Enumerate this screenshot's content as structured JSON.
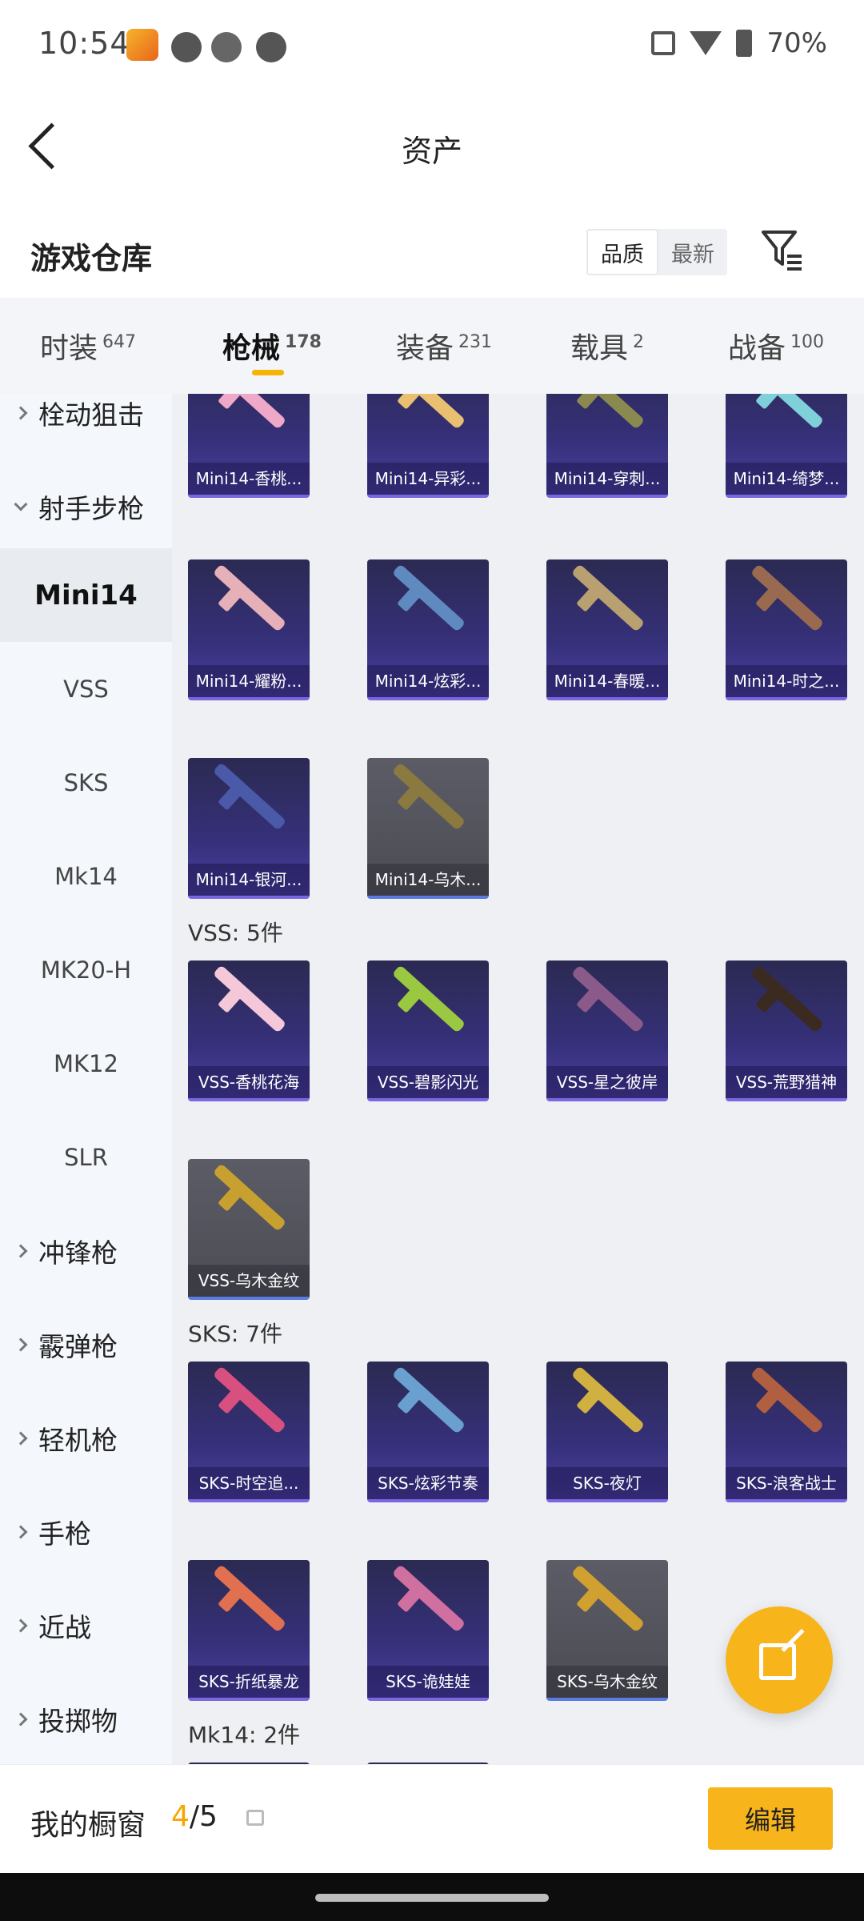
{
  "status_bar": {
    "time": "10:54",
    "battery": "70%"
  },
  "header": {
    "title": "资产"
  },
  "section": {
    "title": "游戏仓库",
    "sort_quality": "品质",
    "sort_latest": "最新"
  },
  "tabs": [
    {
      "label": "时装",
      "count": "647"
    },
    {
      "label": "枪械",
      "count": "178"
    },
    {
      "label": "装备",
      "count": "231"
    },
    {
      "label": "载具",
      "count": "2"
    },
    {
      "label": "战备",
      "count": "100"
    }
  ],
  "sidebar": {
    "items": [
      {
        "label": "栓动狙击"
      },
      {
        "label": "射手步枪"
      },
      {
        "label": "Mini14"
      },
      {
        "label": "VSS"
      },
      {
        "label": "SKS"
      },
      {
        "label": "Mk14"
      },
      {
        "label": "MK20-H"
      },
      {
        "label": "MK12"
      },
      {
        "label": "SLR"
      },
      {
        "label": "冲锋枪"
      },
      {
        "label": "霰弹枪"
      },
      {
        "label": "轻机枪"
      },
      {
        "label": "手枪"
      },
      {
        "label": "近战"
      },
      {
        "label": "投掷物"
      }
    ]
  },
  "groups": {
    "mini14": {
      "items": [
        "Mini14-香桃...",
        "Mini14-异彩...",
        "Mini14-穿刺...",
        "Mini14-绮梦...",
        "Mini14-耀粉...",
        "Mini14-炫彩...",
        "Mini14-春暖...",
        "Mini14-时之...",
        "Mini14-银河...",
        "Mini14-乌木..."
      ]
    },
    "vss": {
      "label": "VSS: 5件",
      "items": [
        "VSS-香桃花海",
        "VSS-碧影闪光",
        "VSS-星之彼岸",
        "VSS-荒野猎神",
        "VSS-乌木金纹"
      ]
    },
    "sks": {
      "label": "SKS: 7件",
      "items": [
        "SKS-时空追...",
        "SKS-炫彩节奏",
        "SKS-夜灯",
        "SKS-浪客战士",
        "SKS-折纸暴龙",
        "SKS-诡娃娃",
        "SKS-乌木金纹"
      ]
    },
    "mk14": {
      "label": "Mk14: 2件"
    }
  },
  "bottom": {
    "label": "我的橱窗",
    "current": "4",
    "total": "/5",
    "edit": "编辑"
  },
  "colors": {
    "accent": "#f8b41b",
    "purple_card": "#36307a",
    "gray_card": "#55555e"
  }
}
